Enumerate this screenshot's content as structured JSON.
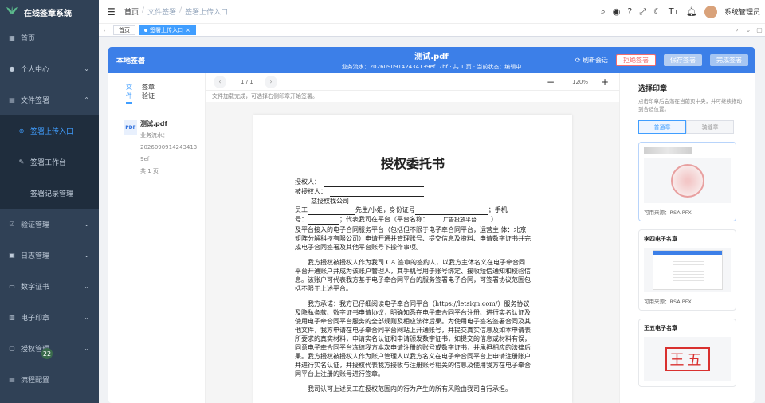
{
  "app": {
    "title": "在线签章系统"
  },
  "sidebar": {
    "items": [
      {
        "label": "首页",
        "icon": "dashboard-icon"
      },
      {
        "label": "个人中心",
        "icon": "user-icon"
      },
      {
        "label": "文件签署",
        "icon": "document-icon"
      },
      {
        "label": "签署上传入口",
        "icon": "upload-icon"
      },
      {
        "label": "签署工作台",
        "icon": "edit-icon"
      },
      {
        "label": "签署记录管理",
        "icon": ""
      },
      {
        "label": "验证管理",
        "icon": "check-icon"
      },
      {
        "label": "日志管理",
        "icon": "log-icon"
      },
      {
        "label": "数字证书",
        "icon": "certificate-icon"
      },
      {
        "label": "电子印章",
        "icon": "seal-icon"
      },
      {
        "label": "授权管理",
        "icon": "auth-icon"
      },
      {
        "label": "流程配置",
        "icon": "flow-icon"
      }
    ],
    "badge": "22"
  },
  "breadcrumb": {
    "home": "首页",
    "section": "文件签署",
    "page": "签署上传入口"
  },
  "user": {
    "name": "系统管理员"
  },
  "tabs": {
    "home": "首页",
    "active": "签署上传入口"
  },
  "header": {
    "left_title": "本地签署",
    "file_name": "测试.pdf",
    "meta": "业务流水：2026090914243413​9ef17bf · 共 1 页 · 当前状态：编辑中",
    "refresh": "刷新会话",
    "reject": "拒绝签署",
    "save": "保存签署",
    "done": "完成签署"
  },
  "file_panel": {
    "tab_file": "文\n件",
    "tab_verify": "签章\n验证",
    "icon_text": "PDF",
    "file_name": "测试.pdf",
    "flow_label": "业务流水：",
    "flow_no": "2026090914243413​9ef",
    "pages": "共 1 页"
  },
  "viewer": {
    "page_indicator": "1 / 1",
    "zoom": "120%",
    "hint": "文件加载完成，可选择右侧印章开始签署。"
  },
  "document": {
    "title": "授权委托书",
    "l1": "授权人：",
    "l2": "被授权人：",
    "l3": "兹授权我公司",
    "l4a": "员工",
    "l4b": "先生/小姐，身份证号",
    "l4c": "；手机",
    "l5a": "号：",
    "l5b": "；代表我司在平台（平台名称：",
    "l5c": "广告投放平台",
    "l5d": "）",
    "p1": "及平台接入的电子合同服务平台（包括但不限于电子牵合同平台，运营主 体：北京矩阵分解科技有限公司）申请开通并管理账号、提交信息及资料、申请数字证书并完成电子合同签署及其他平台账号下操作事项。",
    "p2": "我方授权被授权人作为我司 CA 签章的签约人，以我方主体名义在电子牵合同平台开通账户并成为该账户管理人，其手机号用于账号绑定、接收短信通知和校验信息。该账户可代表我方基于电子牵合同平台的服务签署电子合同，可签署协议范围包括不限于上述平台。",
    "p3": "我方承诺：我方已仔细阅读电子牵合同平台（https://letsign.com/）服务协议及隐私条款、数字证书申请协议，明确知悉在电子牵合同平台注册、进行实名认证及使用电子牵合同平台服务的全部规则及相应法律后果。为使用电子签名签署合同及其他文件，我方申请在电子牵合同平台网站上开通账号，并提交真实信息及如本申请表所要求的真实材料，申请实名认证和申请颁发数字证书，如提交的信息或材料有误，同意电子牵合同平台冻结我方本次申请注册的账号或数字证书，并承担相应的法律后果。我方授权被授权人作为账户管理人以我方名义在电子牵合同平台上申请注册账户并进行实名认证，并授权代表我方接收与注册账号相关的信息及使用我方在电子牵合同平台上注册的账号进行签章。",
    "p4": "我司认可上述员工在授权范围内的行为产生的所有风险由我司自行承担。"
  },
  "seal_panel": {
    "title": "选择印章",
    "desc": "点击印章后会落在当前页中央，并可继续拖动到合适位置。",
    "tab_normal": "普通章",
    "tab_seam": "骑缝章",
    "cards": [
      {
        "name": "",
        "source": "可用来源：RSA PFX"
      },
      {
        "name": "李四电子名章",
        "source": "可用来源：RSA PFX"
      },
      {
        "name": "王五电子名章",
        "seal_text": "王五",
        "source": ""
      }
    ]
  },
  "colors": {
    "sidebar": "#304156",
    "primary": "#409eff",
    "header": "#3c7fe8",
    "reject": "#f56c6c"
  }
}
